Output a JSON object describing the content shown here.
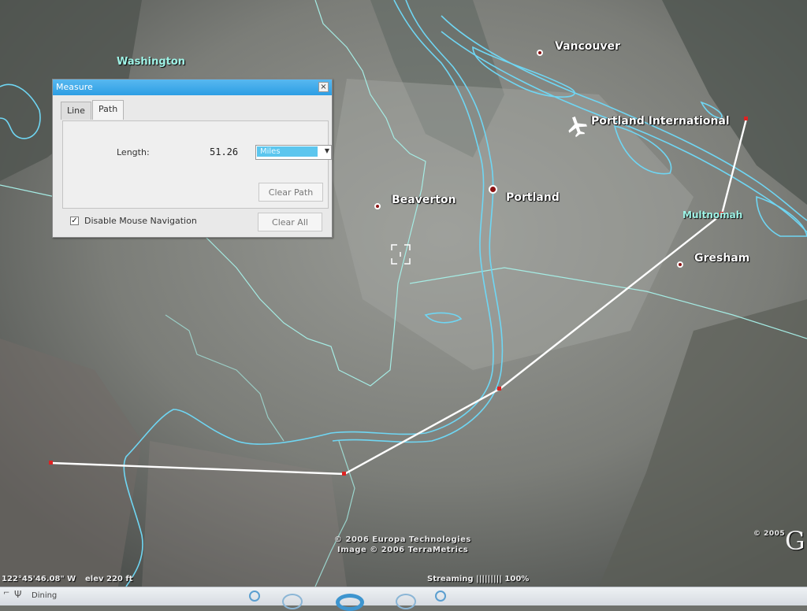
{
  "map": {
    "places": {
      "vancouver": "Vancouver",
      "portland_international": "Portland International",
      "portland": "Portland",
      "beaverton": "Beaverton",
      "gresham": "Gresham",
      "multnomah": "Multnomah",
      "washington": "Washington"
    },
    "credits": {
      "line1": "© 2006 Europa Technologies",
      "line2": "Image © 2006 TerraMetrics",
      "right": "© 2005"
    },
    "logo_letter": "G",
    "status": {
      "coords": "122°45'46.08\" W",
      "elev": "elev  220 ft",
      "streaming": "Streaming ||||||||| 100%"
    },
    "colors": {
      "boundary": "#9fe9e0",
      "water": "#6fd6f3",
      "path": "#ffffff",
      "marker": "#8b1212"
    }
  },
  "measure": {
    "title": "Measure",
    "close_glyph": "×",
    "tabs": [
      "Line",
      "Path"
    ],
    "active_tab": "Path",
    "length_label": "Length:",
    "length_value": "51.26",
    "unit": "Miles",
    "clear_path": "Clear Path",
    "clear_all": "Clear All",
    "disable_mouse_nav": "Disable Mouse Navigation",
    "disable_mouse_nav_checked": true,
    "check_glyph": "✓"
  },
  "taskbar": {
    "dining": "Dining",
    "pin_icon_glyph": "Ψ"
  }
}
